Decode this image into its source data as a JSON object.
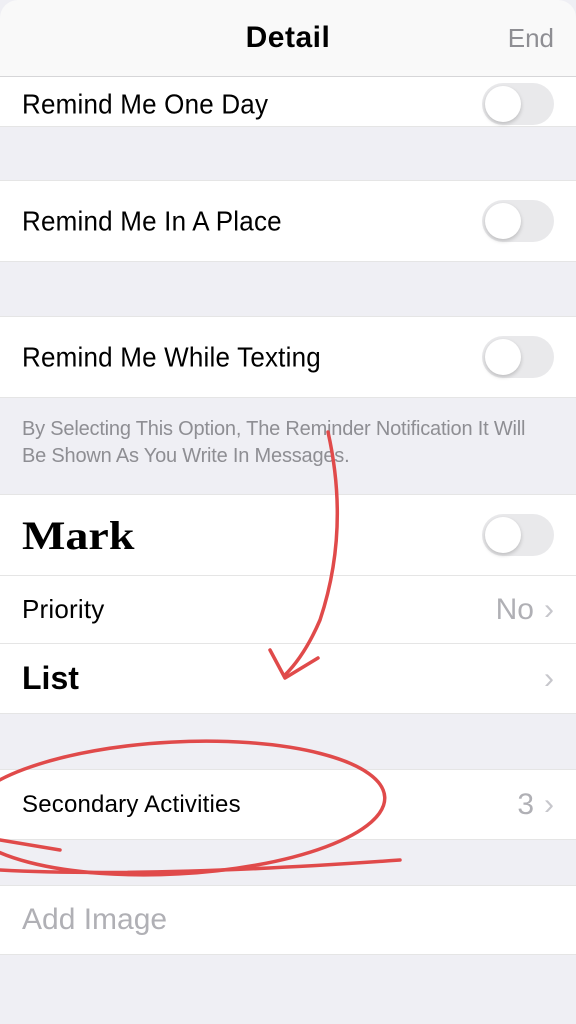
{
  "header": {
    "title": "Detail",
    "end": "End"
  },
  "rows": {
    "one_day": "Remind Me One Day",
    "place": "Remind Me In A Place",
    "texting": "Remind Me While Texting",
    "mark": "Mark",
    "priority": {
      "label": "Priority",
      "value": "No"
    },
    "list": "List",
    "secondary": {
      "label": "Secondary Activities",
      "value": "3"
    },
    "add_image": "Add Image"
  },
  "footer": "By Selecting This Option, The Reminder Notification It Will Be Shown As You Write In Messages.",
  "toggles": {
    "one_day": false,
    "place": false,
    "texting": false,
    "mark": false
  },
  "annotation_color": "#e04a4a"
}
